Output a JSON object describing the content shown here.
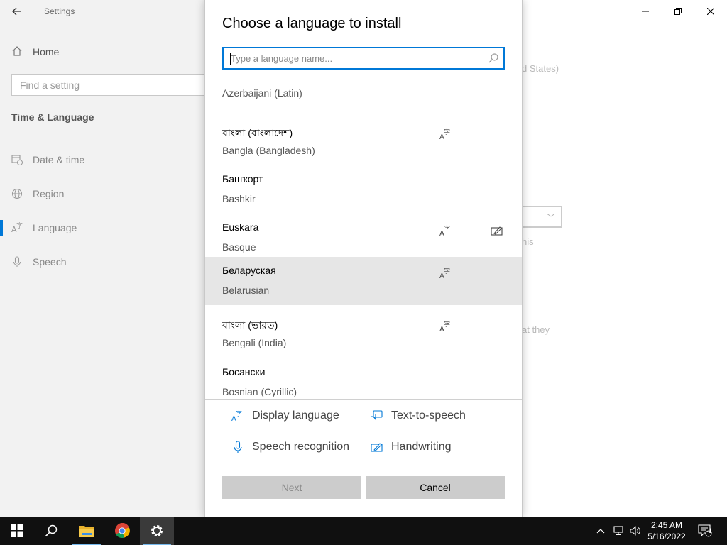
{
  "settings": {
    "window_title": "Settings",
    "home_label": "Home",
    "search_placeholder": "Find a setting",
    "section_title": "Time & Language",
    "nav": [
      {
        "label": "Date & time",
        "icon": "calendar-clock-icon"
      },
      {
        "label": "Region",
        "icon": "globe-icon"
      },
      {
        "label": "Language",
        "icon": "language-icon"
      },
      {
        "label": "Speech",
        "icon": "microphone-icon"
      }
    ],
    "active_nav": "Language",
    "background_fragments": [
      "d States)",
      "his",
      "at they"
    ]
  },
  "dialog": {
    "title": "Choose a language to install",
    "search_placeholder": "Type a language name...",
    "search_value": "",
    "languages": [
      {
        "native": "",
        "english": "Azerbaijani (Latin)",
        "features": [
          "display-language"
        ]
      },
      {
        "native": "বাংলা (বাংলাদেশ)",
        "english": "Bangla (Bangladesh)",
        "features": [
          "display-language"
        ]
      },
      {
        "native": "Башҡорт",
        "english": "Bashkir",
        "features": []
      },
      {
        "native": "Euskara",
        "english": "Basque",
        "features": [
          "display-language",
          "handwriting"
        ]
      },
      {
        "native": "Беларуская",
        "english": "Belarusian",
        "features": [
          "display-language"
        ],
        "selected": true
      },
      {
        "native": "বাংলা (ভারত)",
        "english": "Bengali (India)",
        "features": [
          "display-language"
        ]
      },
      {
        "native": "Босански",
        "english": "Bosnian (Cyrillic)",
        "features": []
      }
    ],
    "legend": {
      "display_language": "Display language",
      "text_to_speech": "Text-to-speech",
      "speech_recognition": "Speech recognition",
      "handwriting": "Handwriting"
    },
    "buttons": {
      "next": "Next",
      "cancel": "Cancel"
    }
  },
  "taskbar": {
    "pinned": [
      "windows-start-icon",
      "search-icon",
      "file-explorer-icon",
      "chrome-icon",
      "settings-gear-icon"
    ],
    "time": "2:45 AM",
    "date": "5/16/2022",
    "notification_count": "1"
  },
  "colors": {
    "accent": "#0078d7",
    "selected_row": "#e6e6e6",
    "button_bg": "#cccccc",
    "taskbar": "#101010"
  }
}
